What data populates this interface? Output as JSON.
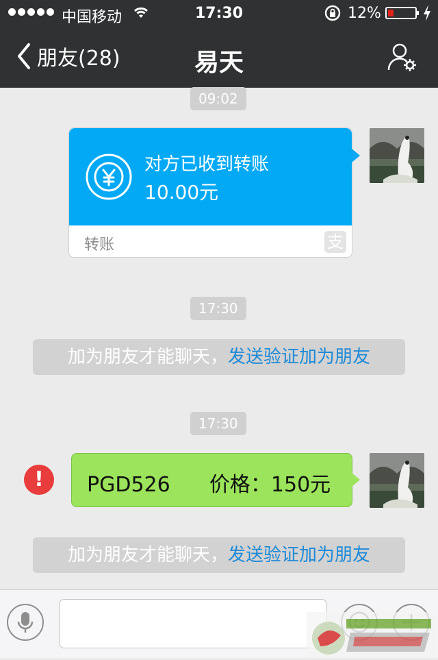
{
  "status_bar": {
    "carrier": "中国移动",
    "time": "17:30",
    "battery_percent": "12%",
    "signal_bars": 5,
    "battery_level": 0.12,
    "icons": [
      "signal-dots-icon",
      "wifi-icon",
      "rotation-lock-icon",
      "battery-icon",
      "charging-bolt-icon"
    ]
  },
  "nav": {
    "back_label": "朋友(28)",
    "title": "易天",
    "profile_icon": "person-settings-icon"
  },
  "messages": {
    "timestamp_1": "09:02",
    "transfer": {
      "status": "对方已收到转账",
      "amount": "10.00元",
      "label": "转账",
      "badge": "支",
      "color": "#03a9f4"
    },
    "timestamp_2": "17:30",
    "notice_1": {
      "text": "加为朋友才能聊天，",
      "link": "发送验证加为朋友"
    },
    "timestamp_3": "17:30",
    "sent_text": "PGD526      价格：150元",
    "error_mark": "!",
    "notice_2": {
      "text": "加为朋友才能聊天，",
      "link": "发送验证加为朋友"
    }
  },
  "input_bar": {
    "placeholder": "",
    "icons": [
      "microphone-icon",
      "emoji-icon",
      "plus-icon"
    ]
  },
  "colors": {
    "nav_bg": "#2f3133",
    "chat_bg": "#ebebeb",
    "sent_bubble": "#9be45b",
    "link": "#1e8ad8",
    "error": "#e93c3c"
  }
}
